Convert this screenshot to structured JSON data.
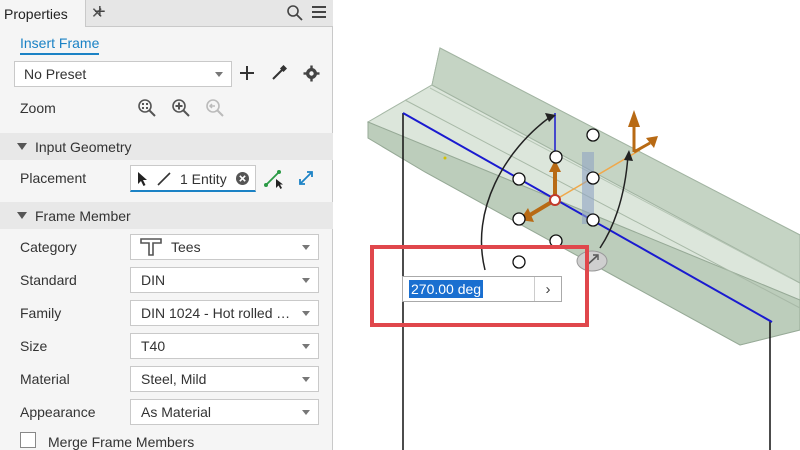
{
  "panel": {
    "tab_label": "Properties",
    "tab_close": "✕",
    "tab_add": "+",
    "title": "Insert Frame",
    "preset": "No Preset",
    "zoom_label": "Zoom"
  },
  "input_geometry": {
    "title": "Input Geometry",
    "placement_label": "Placement",
    "placement_value": "1 Entity"
  },
  "frame_member": {
    "title": "Frame Member",
    "fields": [
      {
        "label": "Category",
        "value": "Tees"
      },
      {
        "label": "Standard",
        "value": "DIN"
      },
      {
        "label": "Family",
        "value": "DIN 1024 - Hot rolled T..."
      },
      {
        "label": "Size",
        "value": "T40"
      },
      {
        "label": "Material",
        "value": "Steel, Mild"
      },
      {
        "label": "Appearance",
        "value": "As Material"
      }
    ],
    "merge_label": "Merge Frame Members"
  },
  "canvas": {
    "angle_value": "270.00 deg",
    "angle_go": "›"
  },
  "colors": {
    "accent": "#1b82c5",
    "highlight_frame": "#e0474c",
    "path_line": "#1a1ad0",
    "beam_fill": "#cfdccd",
    "gizmo_arrow": "#b86a14"
  }
}
